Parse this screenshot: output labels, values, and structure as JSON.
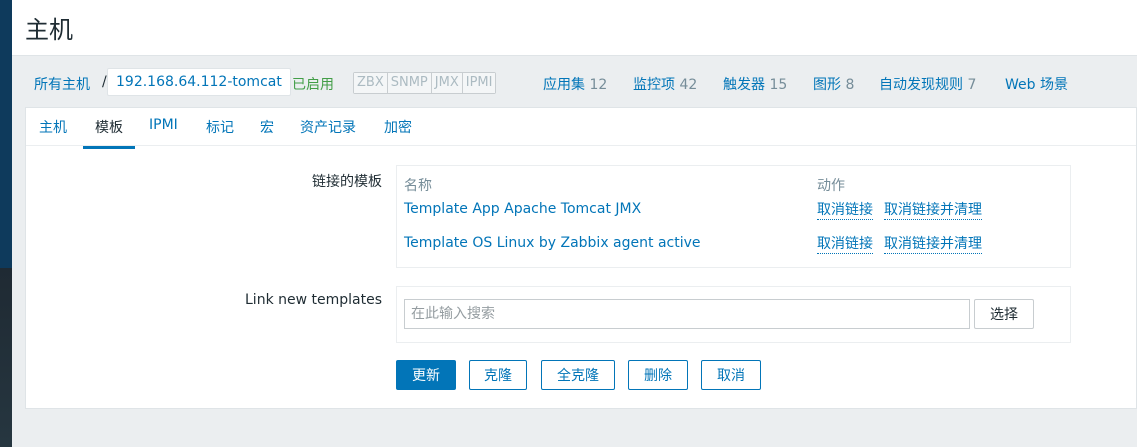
{
  "page": {
    "title": "主机"
  },
  "breadcrumb": {
    "all_hosts": "所有主机",
    "separator": "/",
    "host": "192.168.64.112-tomcat",
    "status": "已启用",
    "interfaces": [
      "ZBX",
      "SNMP",
      "JMX",
      "IPMI"
    ],
    "links": [
      {
        "label": "应用集",
        "count": "12"
      },
      {
        "label": "监控项",
        "count": "42"
      },
      {
        "label": "触发器",
        "count": "15"
      },
      {
        "label": "图形",
        "count": "8"
      },
      {
        "label": "自动发现规则",
        "count": "7"
      },
      {
        "label": "Web 场景",
        "count": ""
      }
    ]
  },
  "tabs": [
    "主机",
    "模板",
    "IPMI",
    "标记",
    "宏",
    "资产记录",
    "加密"
  ],
  "active_tab": "模板",
  "linked_templates": {
    "label": "链接的模板",
    "col_name": "名称",
    "col_action": "动作",
    "rows": [
      {
        "name": "Template App Apache Tomcat JMX",
        "unlink": "取消链接",
        "unlink_clear": "取消链接并清理"
      },
      {
        "name": "Template OS Linux by Zabbix agent active",
        "unlink": "取消链接",
        "unlink_clear": "取消链接并清理"
      }
    ]
  },
  "link_new": {
    "label": "Link new templates",
    "placeholder": "在此输入搜索",
    "select_label": "选择"
  },
  "buttons": {
    "update": "更新",
    "clone": "克隆",
    "full_clone": "全克隆",
    "delete": "删除",
    "cancel": "取消"
  },
  "colors": {
    "accent": "#0275b8",
    "enabled": "#429e47",
    "disabled_interface": "#acbbc2"
  }
}
